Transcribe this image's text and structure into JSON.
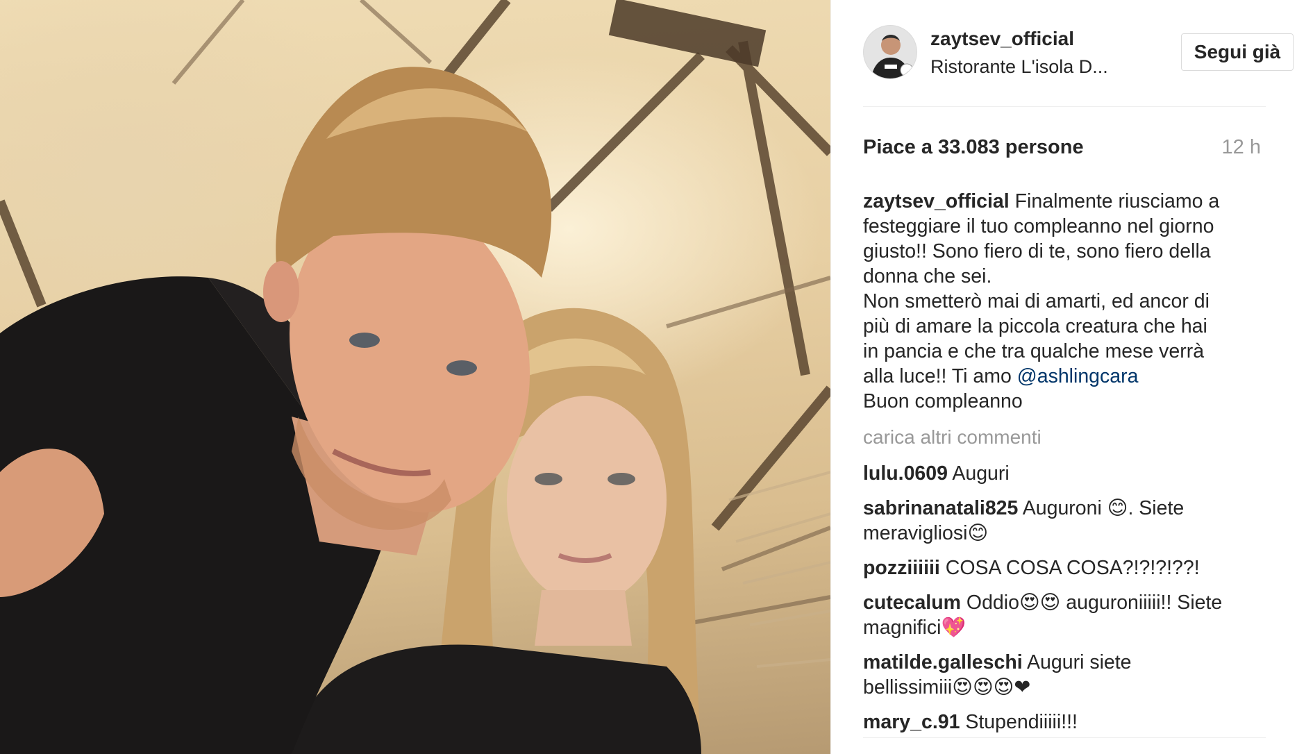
{
  "header": {
    "username": "zaytsev_official",
    "location": "Ristorante L'isola D...",
    "follow_label": "Segui già"
  },
  "stats": {
    "likes": "Piace a 33.083 persone",
    "time_ago": "12 h"
  },
  "caption": {
    "username": "zaytsev_official",
    "line1": "Finalmente riusciamo a",
    "line2": "festeggiare il tuo compleanno nel giorno",
    "line3": "giusto!! Sono fiero di te, sono fiero della",
    "line4": "donna che sei.",
    "line5": "Non smetterò mai di amarti, ed ancor di",
    "line6": "più di amare la piccola creatura che hai",
    "line7": "in pancia e che tra qualche mese verrà",
    "line8": "alla luce!! Ti amo",
    "mention": "@ashlingcara",
    "line9": "Buon compleanno"
  },
  "load_more": "carica altri commenti",
  "comments": [
    {
      "username": "lulu.0609",
      "lines": [
        "Auguri"
      ]
    },
    {
      "username": "sabrinanatali825",
      "lines": [
        "Auguroni 😊. Siete",
        "meravigliosi😊"
      ]
    },
    {
      "username": "pozziiiiii",
      "lines": [
        "COSA COSA COSA?!?!?!??!"
      ]
    },
    {
      "username": "cutecalum",
      "lines": [
        "Oddio😍😍 auguroniiiii!! Siete",
        "magnifici💖"
      ]
    },
    {
      "username": "matilde.galleschi",
      "lines": [
        "Auguri siete",
        "bellissimiii😍😍😍❤"
      ]
    },
    {
      "username": "mary_c.91",
      "lines": [
        "Stupendiiiii!!!"
      ]
    }
  ],
  "colors": {
    "text": "#262626",
    "muted": "#999999",
    "link": "#003569",
    "divider": "#efefef"
  },
  "icons": {
    "avatar": "profile-photo"
  }
}
